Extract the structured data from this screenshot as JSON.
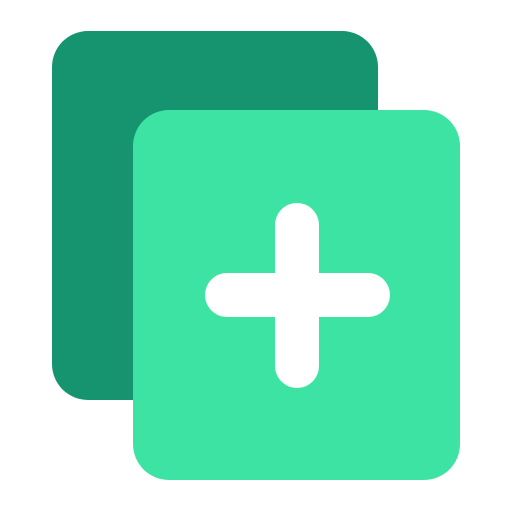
{
  "icon": {
    "name": "add-copy-icon",
    "colors": {
      "back_card": "#16936F",
      "front_card": "#3DE3A3",
      "plus": "#FFFFFF",
      "background": "#FFFFFF"
    }
  }
}
